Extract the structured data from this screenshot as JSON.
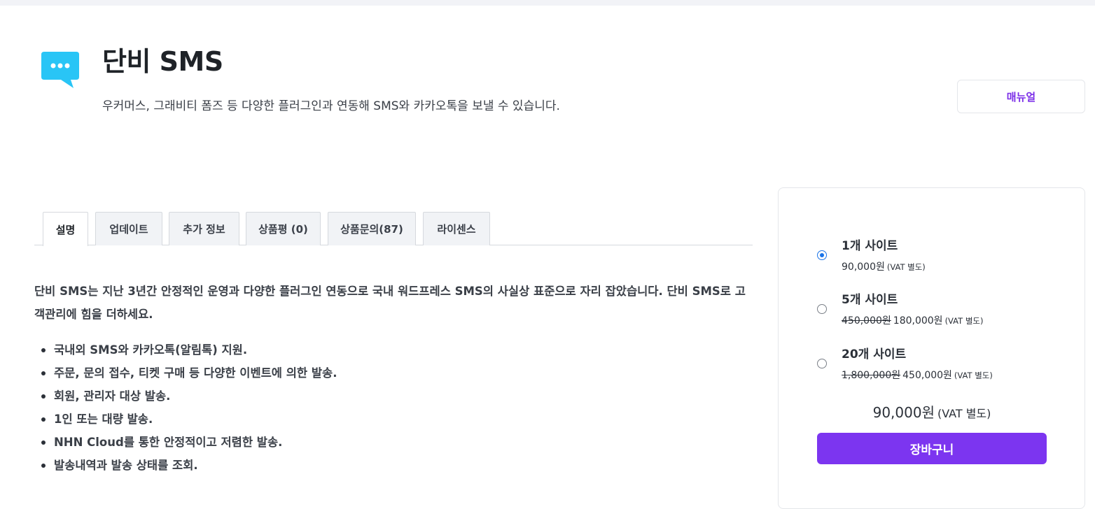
{
  "header": {
    "icon": "chat-bubble-icon",
    "title": "단비 SMS",
    "description": "우커머스, 그래비티 폼즈 등 다양한 플러그인과 연동해 SMS와 카카오톡을 보낼 수 있습니다.",
    "manual_label": "매뉴얼"
  },
  "tabs": [
    {
      "label": "설명",
      "active": true
    },
    {
      "label": "업데이트"
    },
    {
      "label": "추가 정보"
    },
    {
      "label": "상품평 (0)"
    },
    {
      "label": "상품문의(87)"
    },
    {
      "label": "라이센스"
    }
  ],
  "content": {
    "intro": "단비 SMS는 지난 3년간 안정적인 운영과 다양한 플러그인 연동으로 국내 워드프레스 SMS의 사실상 표준으로 자리 잡았습니다. 단비 SMS로 고객관리에 힘을 더하세요.",
    "features": [
      "국내외 SMS와 카카오톡(알림톡) 지원.",
      "주문, 문의 접수, 티켓 구매 등 다양한 이벤트에 의한 발송.",
      "회원, 관리자 대상 발송.",
      "1인 또는 대량 발송.",
      "NHN Cloud를 통한 안정적이고 저렴한 발송.",
      "발송내역과 발송 상태를 조회."
    ]
  },
  "purchase": {
    "options": [
      {
        "title": "1개 사이트",
        "old_price": "",
        "price": "90,000원",
        "vat": "(VAT 별도)",
        "selected": true
      },
      {
        "title": "5개 사이트",
        "old_price": "450,000원",
        "price": "180,000원",
        "vat": "(VAT 별도)",
        "selected": false
      },
      {
        "title": "20개 사이트",
        "old_price": "1,800,000원",
        "price": "450,000원",
        "vat": "(VAT 별도)",
        "selected": false
      }
    ],
    "total": "90,000원",
    "total_vat": "(VAT 별도)",
    "cart_label": "장바구니"
  },
  "colors": {
    "accent": "#7c35f0",
    "manual_text": "#7b2ee8",
    "icon": "#29c5f6",
    "radio_checked": "#1a73e8"
  }
}
